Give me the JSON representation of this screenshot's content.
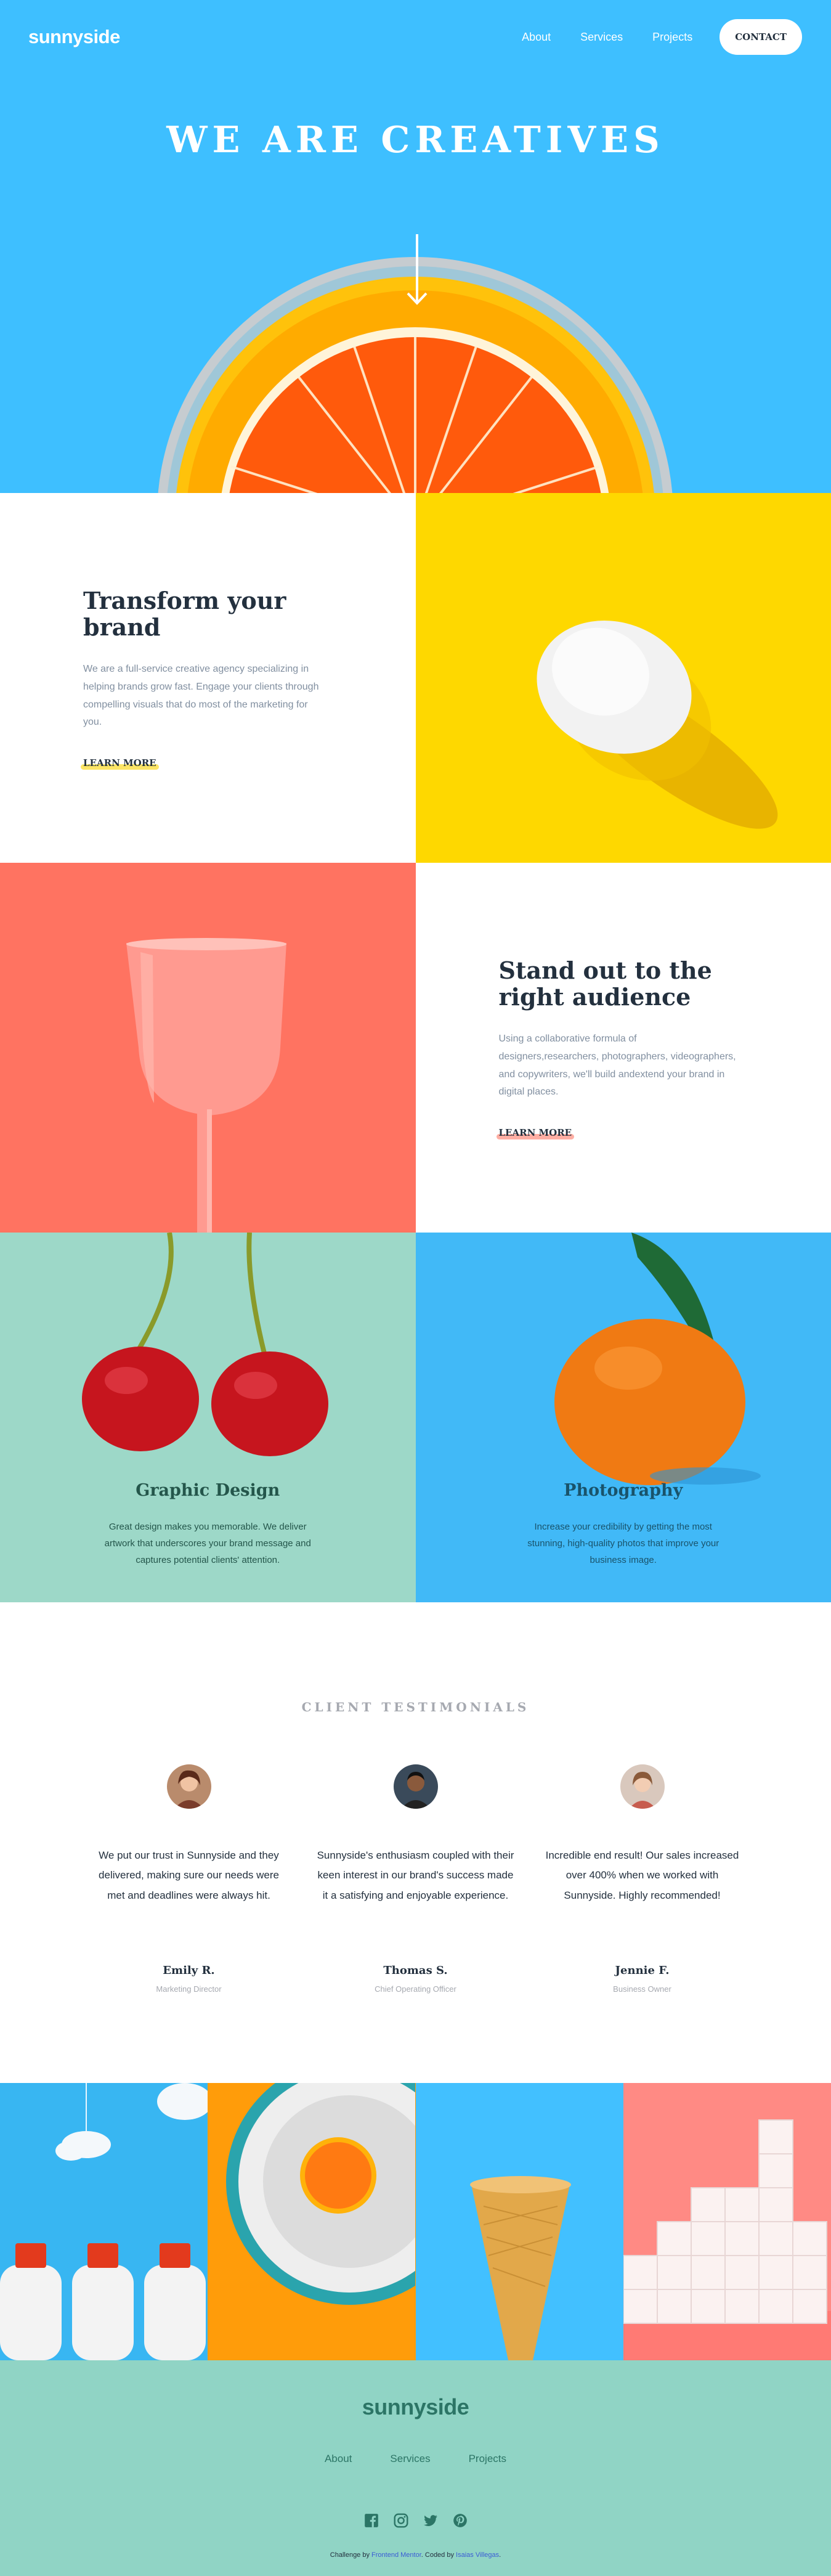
{
  "header": {
    "logo": "sunnyside",
    "nav": [
      "About",
      "Services",
      "Projects"
    ],
    "contact_label": "CONTACT"
  },
  "hero": {
    "title": "WE ARE CREATIVES",
    "arrow_icon": "arrow-down-icon"
  },
  "transform": {
    "title": "Transform your brand",
    "text": "We are a full-service creative agency specializing in helping brands grow fast. Engage your clients through compelling visuals that do most of the marketing for you.",
    "link": "LEARN MORE",
    "accent": "#fad400"
  },
  "standout": {
    "title": "Stand out to the right audience",
    "text": "Using a collaborative formula of designers,researchers, photographers, videographers, and copywriters, we'll build andextend your brand in digital places.",
    "link": "LEARN MORE",
    "accent": "#fe7865"
  },
  "services": [
    {
      "title": "Graphic Design",
      "text": "Great design makes you memorable. We deliver artwork that underscores your brand message and captures potential clients' attention.",
      "color": "#24564b"
    },
    {
      "title": "Photography",
      "text": "Increase your credibility by getting the most stunning, high-quality photos that improve your business image.",
      "color": "#19536b"
    }
  ],
  "testimonials": {
    "title": "CLIENT TESTIMONIALS",
    "items": [
      {
        "quote": "We put our trust in Sunnyside and they delivered, making sure our needs were met and deadlines were always hit.",
        "name": "Emily R.",
        "role": "Marketing Director"
      },
      {
        "quote": "Sunnyside's enthusiasm coupled with their keen interest in our brand's success made it a satisfying and enjoyable experience.",
        "name": "Thomas S.",
        "role": "Chief Operating Officer"
      },
      {
        "quote": "Incredible end result! Our sales increased over 400% when we worked with Sunnyside. Highly recommended!",
        "name": "Jennie F.",
        "role": "Business Owner"
      }
    ]
  },
  "footer": {
    "logo": "sunnyside",
    "links": [
      "About",
      "Services",
      "Projects"
    ],
    "socials": [
      "facebook-icon",
      "instagram-icon",
      "twitter-icon",
      "pinterest-icon"
    ],
    "attribution": {
      "prefix": "Challenge by",
      "challenge_link": "Frontend Mentor",
      "middle": ". Coded by",
      "author_link": "Isaias Villegas",
      "suffix": "."
    }
  }
}
